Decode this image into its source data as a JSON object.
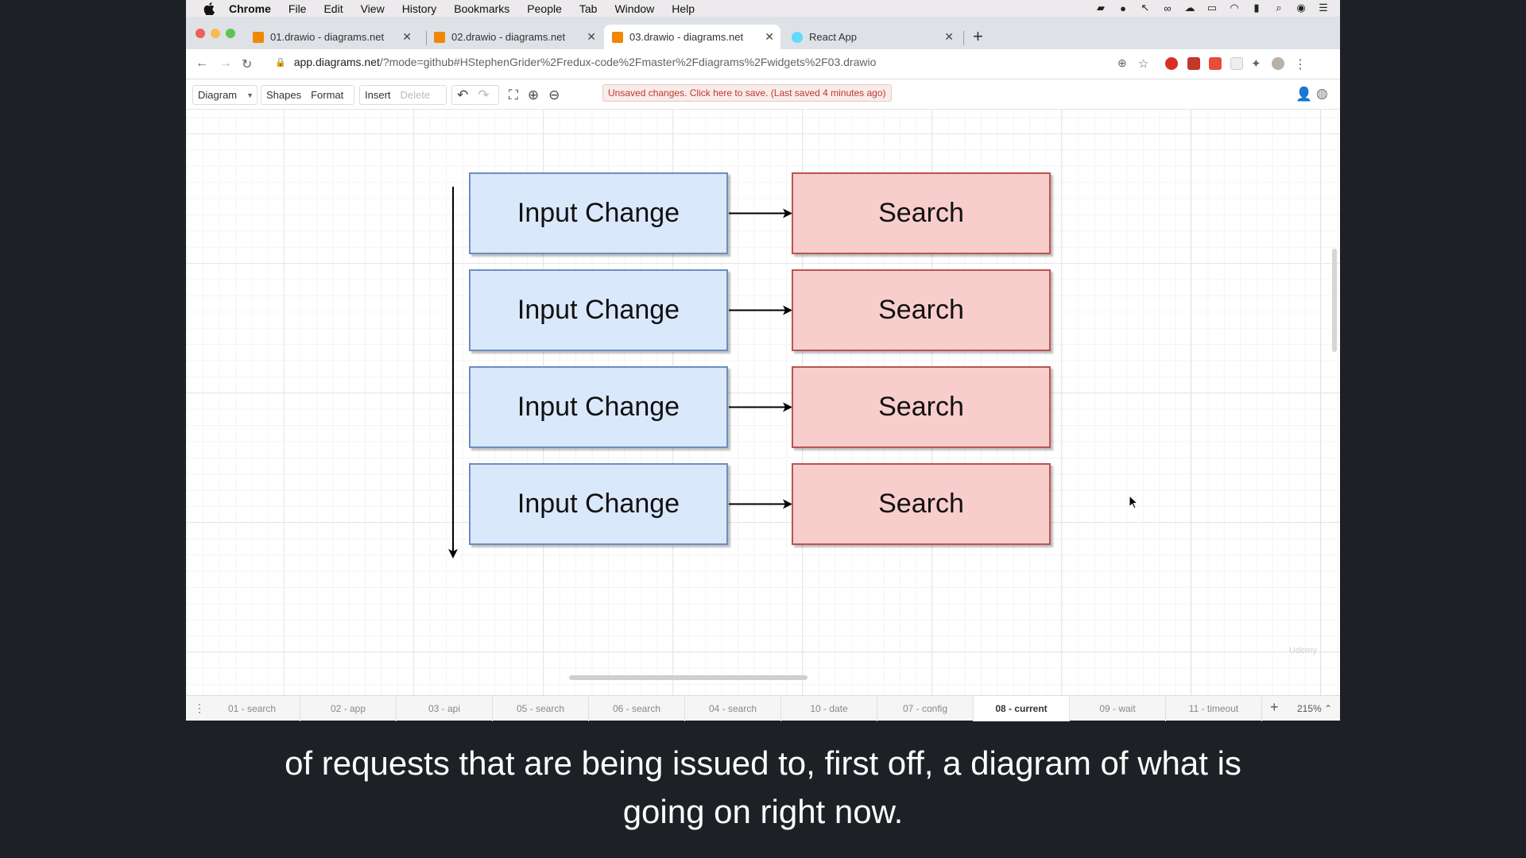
{
  "menubar": {
    "items": [
      "Chrome",
      "File",
      "Edit",
      "View",
      "History",
      "Bookmarks",
      "People",
      "Tab",
      "Window",
      "Help"
    ]
  },
  "tabs": [
    {
      "title": "01.drawio - diagrams.net",
      "active": false
    },
    {
      "title": "02.drawio - diagrams.net",
      "active": false
    },
    {
      "title": "03.drawio - diagrams.net",
      "active": true
    },
    {
      "title": "React App",
      "active": false
    }
  ],
  "address": {
    "host": "app.diagrams.net",
    "path": "/?mode=github#HStephenGrider%2Fredux-code%2Fmaster%2Fdiagrams%2Fwidgets%2F03.drawio"
  },
  "toolbar": {
    "diagram": "Diagram",
    "shapes": "Shapes",
    "format": "Format",
    "insert": "Insert",
    "delete": "Delete",
    "unsaved": "Unsaved changes. Click here to save. (Last saved 4 minutes ago)"
  },
  "diagram": {
    "left_label": "Input Change",
    "right_label": "Search",
    "rows": 4
  },
  "pages": [
    "01 - search",
    "02 - app",
    "03 - api",
    "05 - search",
    "06 - search",
    "04 - search",
    "10 - date",
    "07 - config",
    "08 - current",
    "09 - wait",
    "11 - timeout"
  ],
  "active_page": "08 - current",
  "zoom": "215%",
  "watermark": "Udemy",
  "caption": {
    "line1": "of requests that are being issued to, first off, a diagram of what is",
    "line2": "going on right now."
  },
  "colors": {
    "blue_fill": "#dae8fc",
    "blue_stroke": "#6c8ebf",
    "red_fill": "#f8cecc",
    "red_stroke": "#b85450"
  }
}
